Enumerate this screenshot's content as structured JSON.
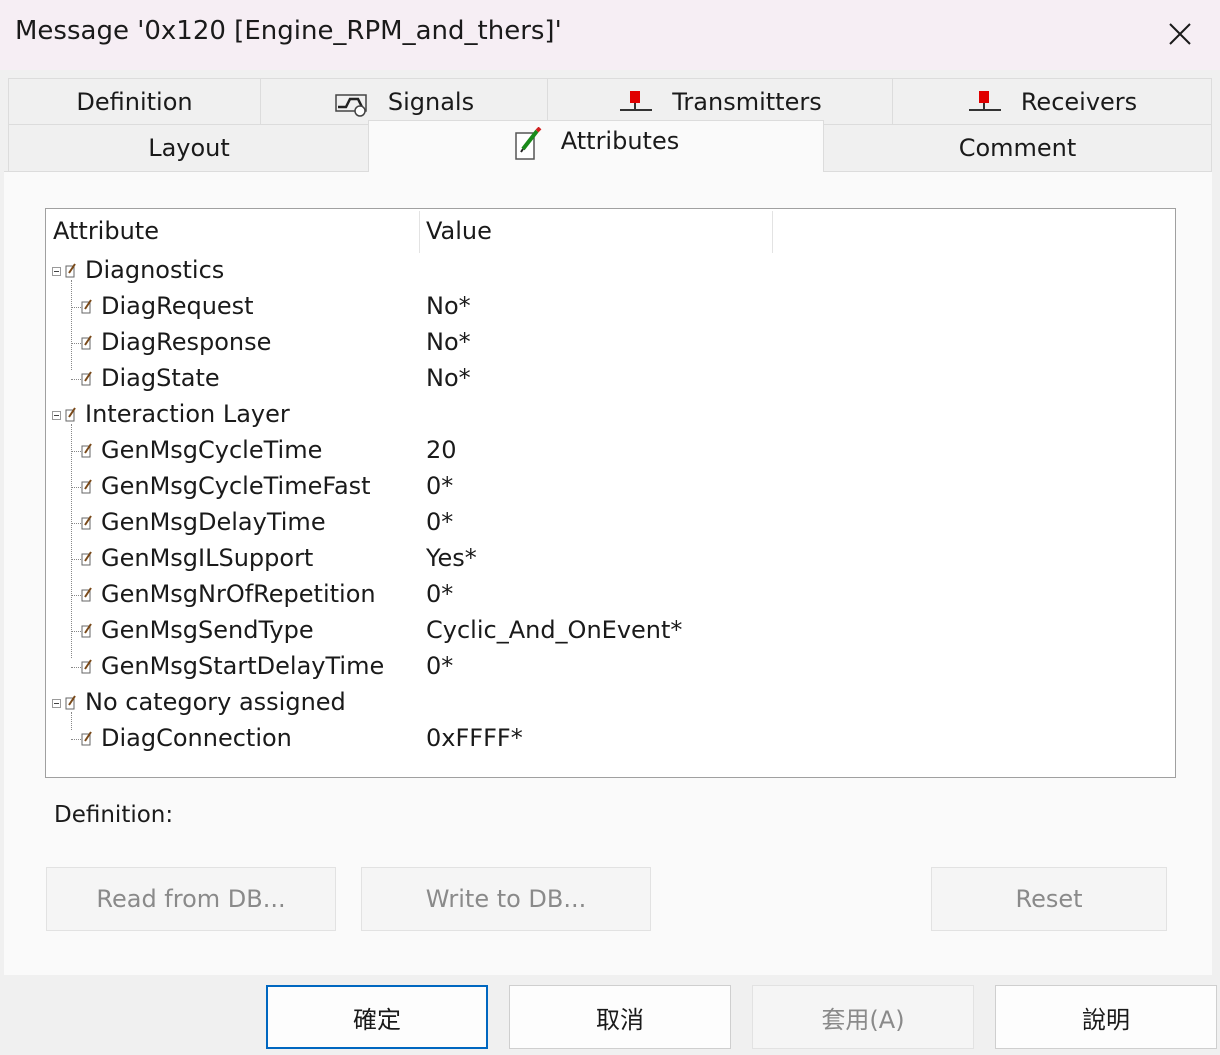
{
  "window": {
    "title": "Message '0x120 [Engine_RPM_and_thers]'"
  },
  "tabs": {
    "row1": [
      {
        "label": "Definition",
        "icon": ""
      },
      {
        "label": "Signals",
        "icon": "signal-icon"
      },
      {
        "label": "Transmitters",
        "icon": "node-icon"
      },
      {
        "label": "Receivers",
        "icon": "node-icon"
      }
    ],
    "row2": [
      {
        "label": "Layout",
        "icon": ""
      },
      {
        "label": "Attributes",
        "icon": "attribute-pencil-icon"
      },
      {
        "label": "Comment",
        "icon": ""
      }
    ],
    "active": "Attributes"
  },
  "tree": {
    "columns": [
      "Attribute",
      "Value"
    ],
    "groups": [
      {
        "name": "Diagnostics",
        "items": [
          {
            "name": "DiagRequest",
            "value": "No*"
          },
          {
            "name": "DiagResponse",
            "value": "No*"
          },
          {
            "name": "DiagState",
            "value": "No*"
          }
        ]
      },
      {
        "name": "Interaction Layer",
        "items": [
          {
            "name": "GenMsgCycleTime",
            "value": "20"
          },
          {
            "name": "GenMsgCycleTimeFast",
            "value": "0*"
          },
          {
            "name": "GenMsgDelayTime",
            "value": "0*"
          },
          {
            "name": "GenMsgILSupport",
            "value": "Yes*"
          },
          {
            "name": "GenMsgNrOfRepetition",
            "value": "0*"
          },
          {
            "name": "GenMsgSendType",
            "value": "Cyclic_And_OnEvent*"
          },
          {
            "name": "GenMsgStartDelayTime",
            "value": "0*"
          }
        ]
      },
      {
        "name": "No category assigned",
        "items": [
          {
            "name": "DiagConnection",
            "value": "0xFFFF*"
          }
        ]
      }
    ]
  },
  "definition": {
    "label": "Definition:"
  },
  "actions": {
    "read": "Read from DB...",
    "write": "Write to DB...",
    "reset": "Reset"
  },
  "footer": {
    "ok": "確定",
    "cancel": "取消",
    "apply": "套用(A)",
    "help": "說明"
  },
  "colors": {
    "accent": "#0067c0",
    "node_icon_red": "#e00000",
    "title_bg": "#f6eef4"
  }
}
